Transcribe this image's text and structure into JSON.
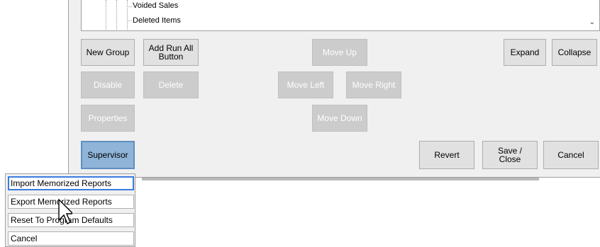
{
  "tree": {
    "items": [
      "Voided Sales",
      "Deleted Items"
    ]
  },
  "buttons": {
    "new_group": "New Group",
    "add_run_all": "Add Run All Button",
    "move_up": "Move Up",
    "expand": "Expand",
    "collapse": "Collapse",
    "disable": "Disable",
    "delete": "Delete",
    "move_left": "Move Left",
    "move_right": "Move Right",
    "properties": "Properties",
    "move_down": "Move Down",
    "supervisor": "Supervisor",
    "revert": "Revert",
    "save_close": "Save / Close",
    "cancel": "Cancel"
  },
  "context_menu": {
    "items": [
      "Import Memorized Reports",
      "Export Memorized Reports",
      "Reset To Program Defaults",
      "Cancel"
    ]
  },
  "colors": {
    "panel": "#f0f0f0",
    "disabled_button": "#cccccc",
    "supervisor_button": "#8fb4d8",
    "menu_selection": "#3a7be0"
  }
}
